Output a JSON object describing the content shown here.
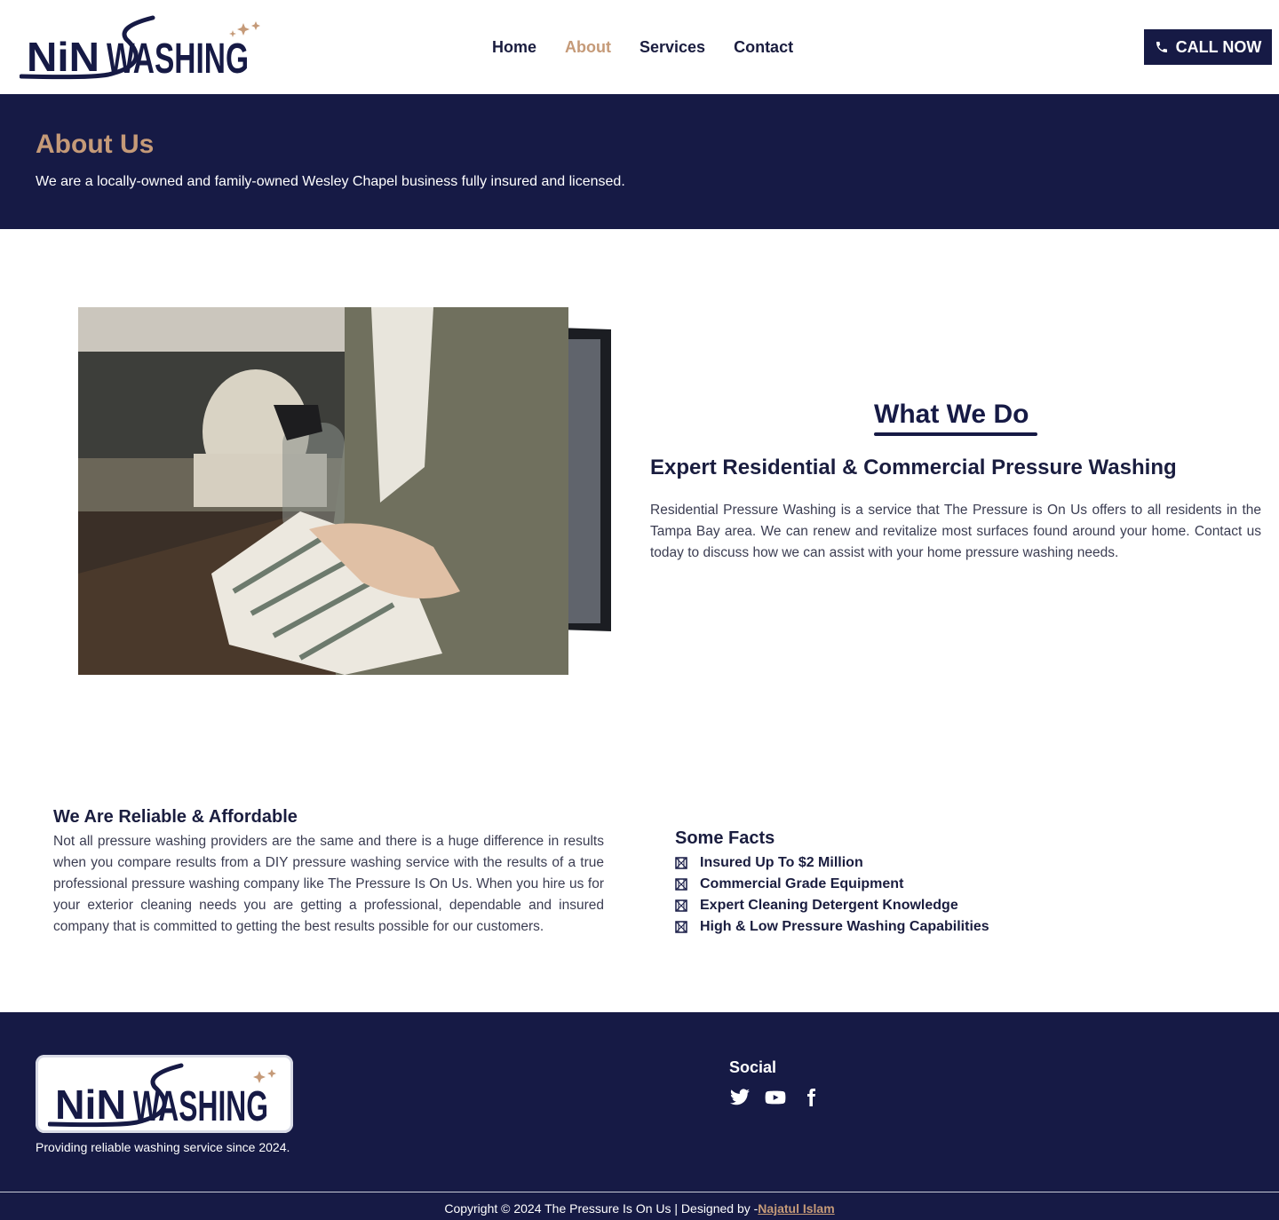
{
  "header": {
    "logo_text": "NiNWASHING",
    "nav": [
      "Home",
      "About",
      "Services",
      "Contact"
    ],
    "active_nav": "About",
    "call_label": "CALL NOW"
  },
  "about": {
    "title": "About Us",
    "subtitle": "We are a locally-owned and family-owned Wesley Chapel business fully insured and licensed."
  },
  "what_we_do": {
    "title": "What We Do",
    "subtitle": "Expert Residential & Commercial Pressure Washing",
    "text": "Residential Pressure Washing is a service that The Pressure is On Us offers to all residents in the Tampa Bay area. We can renew and revitalize most surfaces found around your home. Contact us today to discuss how we can assist with your home pressure washing needs."
  },
  "reliable": {
    "title": "We Are Reliable & Affordable",
    "text": "Not all pressure washing providers are the same and there is a huge difference in results when you compare results from a DIY pressure washing service with the results of a true professional pressure washing company like The Pressure Is On Us. When you hire us for your exterior cleaning needs you are getting a professional, dependable and insured company that is committed to getting the best results possible for our customers."
  },
  "facts": {
    "title": "Some Facts",
    "items": [
      "Insured Up To $2 Million",
      "Commercial Grade Equipment",
      "Expert Cleaning Detergent Knowledge",
      "High & Low Pressure Washing Capabilities"
    ]
  },
  "footer": {
    "tagline": "Providing reliable washing service since 2024.",
    "social_title": "Social",
    "social_icons": [
      "twitter-icon",
      "youtube-icon",
      "facebook-icon"
    ],
    "copyright": "Copyright © 2024 The Pressure Is On Us | Designed by -",
    "designer": "Najatul Islam"
  },
  "colors": {
    "navy": "#161a45",
    "accent": "#c59a78",
    "text": "#1a1d3f"
  }
}
